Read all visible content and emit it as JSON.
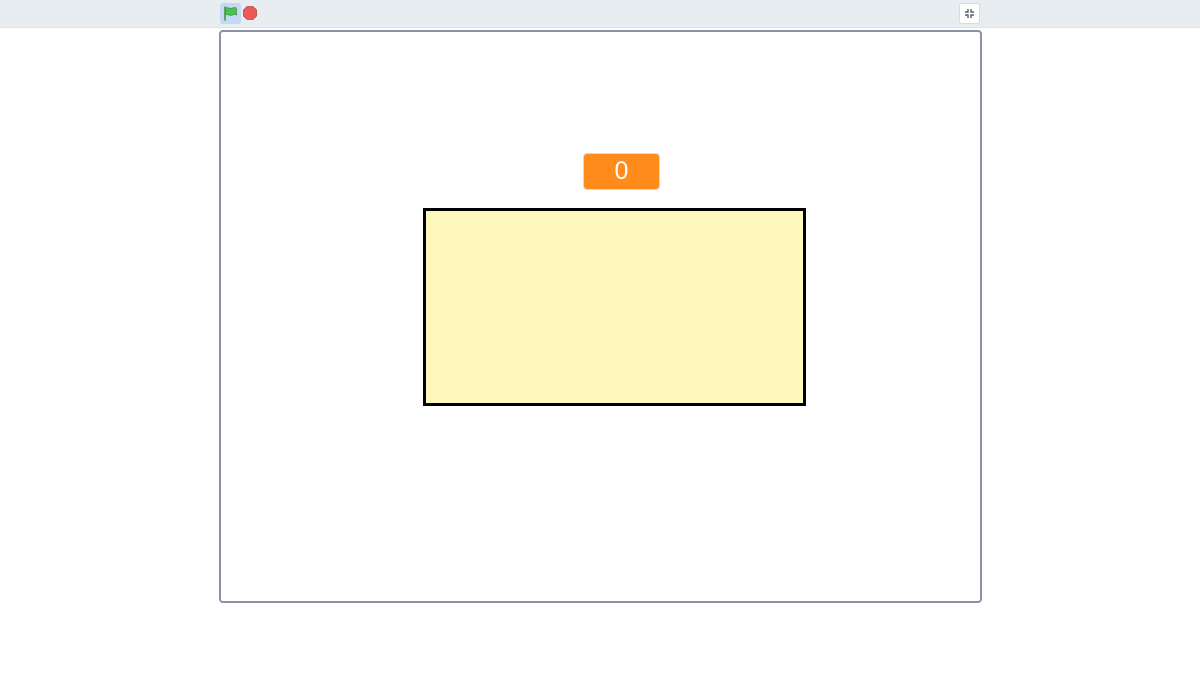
{
  "toolbar": {
    "green_flag_icon": "green-flag-icon",
    "stop_icon": "stop-sign-icon",
    "fullscreen_icon": "exit-fullscreen-icon"
  },
  "stage": {
    "score_value": "0"
  },
  "colors": {
    "toolbar_bg": "#e8edf2",
    "flag_button_bg": "#c5d9f5",
    "flag": "#4cbf56",
    "stop": "#ec5959",
    "score_bg": "#ff8c1a",
    "box_fill": "#fff8bc",
    "box_border": "#000000",
    "stage_border": "#8a93a6"
  }
}
